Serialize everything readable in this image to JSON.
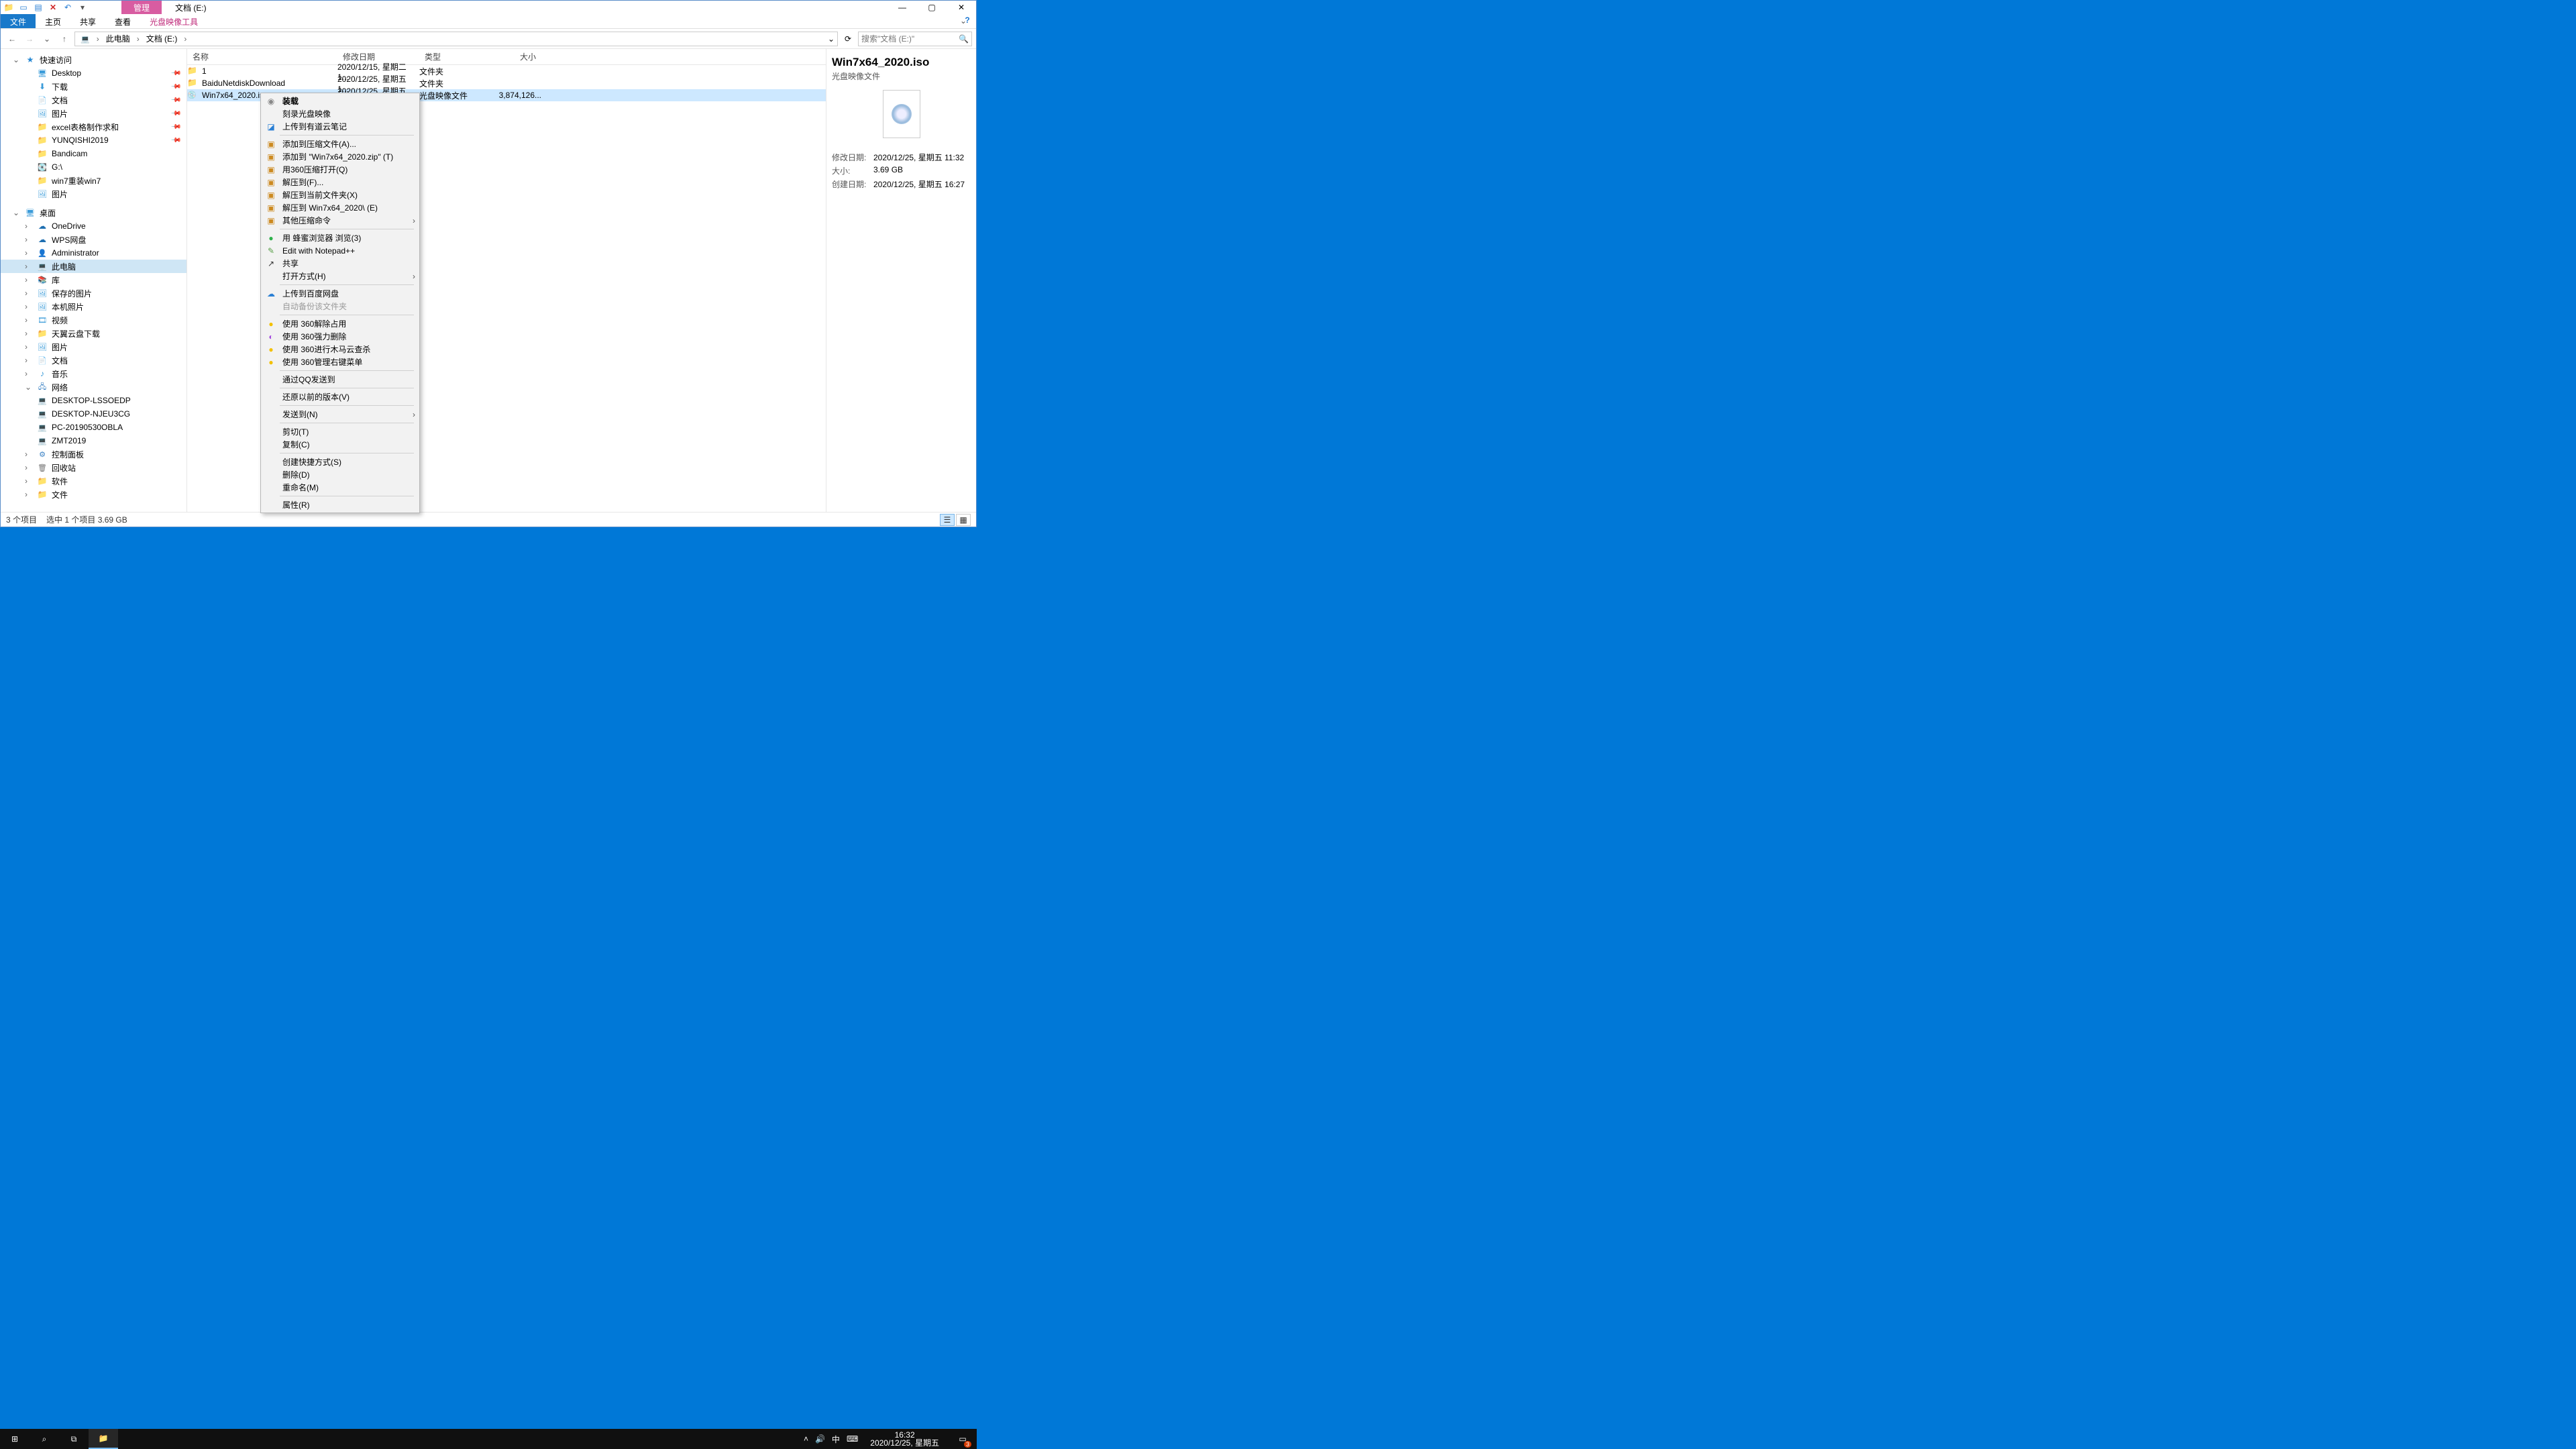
{
  "titlebar": {
    "context_tab": "管理",
    "caption": "文档 (E:)"
  },
  "ribbon": {
    "file": "文件",
    "home": "主页",
    "share": "共享",
    "view": "查看",
    "ctx": "光盘映像工具"
  },
  "nav": {
    "crumbs": [
      "此电脑",
      "文档 (E:)"
    ],
    "search_placeholder": "搜索\"文档 (E:)\""
  },
  "tree": {
    "quick": "快速访问",
    "quick_items": [
      {
        "label": "Desktop",
        "ico": "i-desk",
        "pin": true
      },
      {
        "label": "下载",
        "ico": "i-dl",
        "pin": true
      },
      {
        "label": "文档",
        "ico": "i-doc",
        "pin": true
      },
      {
        "label": "图片",
        "ico": "i-pic",
        "pin": true
      },
      {
        "label": "excel表格制作求和",
        "ico": "i-fold",
        "pin": true
      },
      {
        "label": "YUNQISHI2019",
        "ico": "i-fold",
        "pin": true
      },
      {
        "label": "Bandicam",
        "ico": "i-fold"
      },
      {
        "label": "G:\\",
        "ico": "i-disk"
      },
      {
        "label": "win7重装win7",
        "ico": "i-fold"
      },
      {
        "label": "图片",
        "ico": "i-pic"
      }
    ],
    "desktop": "桌面",
    "desktop_items": [
      {
        "label": "OneDrive",
        "ico": "i-one"
      },
      {
        "label": "WPS网盘",
        "ico": "i-one"
      },
      {
        "label": "Administrator",
        "ico": "i-user"
      },
      {
        "label": "此电脑",
        "ico": "i-pc",
        "sel": true
      },
      {
        "label": "库",
        "ico": "i-lib"
      }
    ],
    "lib_items": [
      {
        "label": "保存的图片",
        "ico": "i-pic"
      },
      {
        "label": "本机照片",
        "ico": "i-pic"
      },
      {
        "label": "视频",
        "ico": "i-vid"
      },
      {
        "label": "天翼云盘下载",
        "ico": "i-fold"
      },
      {
        "label": "图片",
        "ico": "i-pic"
      },
      {
        "label": "文档",
        "ico": "i-doc"
      },
      {
        "label": "音乐",
        "ico": "i-mus"
      }
    ],
    "network": "网络",
    "net_items": [
      {
        "label": "DESKTOP-LSSOEDP",
        "ico": "i-pc"
      },
      {
        "label": "DESKTOP-NJEU3CG",
        "ico": "i-pc"
      },
      {
        "label": "PC-20190530OBLA",
        "ico": "i-pc"
      },
      {
        "label": "ZMT2019",
        "ico": "i-pc"
      }
    ],
    "tail": [
      {
        "label": "控制面板",
        "ico": "i-cpl"
      },
      {
        "label": "回收站",
        "ico": "i-rec"
      },
      {
        "label": "软件",
        "ico": "i-fold"
      },
      {
        "label": "文件",
        "ico": "i-fold"
      }
    ]
  },
  "columns": {
    "name": "名称",
    "date": "修改日期",
    "type": "类型",
    "size": "大小"
  },
  "rows": [
    {
      "name": "1",
      "date": "2020/12/15, 星期二 1...",
      "type": "文件夹",
      "size": "",
      "ico": "i-fold"
    },
    {
      "name": "BaiduNetdiskDownload",
      "date": "2020/12/25, 星期五 1...",
      "type": "文件夹",
      "size": "",
      "ico": "i-fold"
    },
    {
      "name": "Win7x64_2020.iso",
      "date": "2020/12/25, 星期五 1...",
      "type": "光盘映像文件",
      "size": "3,874,126...",
      "ico": "i-iso",
      "sel": true
    }
  ],
  "preview": {
    "title": "Win7x64_2020.iso",
    "type": "光盘映像文件",
    "meta": [
      {
        "k": "修改日期:",
        "v": "2020/12/25, 星期五 11:32"
      },
      {
        "k": "大小:",
        "v": "3.69 GB"
      },
      {
        "k": "创建日期:",
        "v": "2020/12/25, 星期五 16:27"
      }
    ]
  },
  "status": {
    "count": "3 个项目",
    "sel": "选中 1 个项目  3.69 GB"
  },
  "ctx": [
    {
      "t": "装载",
      "ico": "i-cd",
      "bold": true
    },
    {
      "t": "刻录光盘映像"
    },
    {
      "t": "上传到有道云笔记",
      "ico": "i-yd"
    },
    {
      "sep": true
    },
    {
      "t": "添加到压缩文件(A)...",
      "ico": "i-box"
    },
    {
      "t": "添加到 \"Win7x64_2020.zip\" (T)",
      "ico": "i-box"
    },
    {
      "t": "用360压缩打开(Q)",
      "ico": "i-box"
    },
    {
      "t": "解压到(F)...",
      "ico": "i-box"
    },
    {
      "t": "解压到当前文件夹(X)",
      "ico": "i-box"
    },
    {
      "t": "解压到 Win7x64_2020\\ (E)",
      "ico": "i-box"
    },
    {
      "t": "其他压缩命令",
      "ico": "i-box",
      "sub": true
    },
    {
      "sep": true
    },
    {
      "t": "用 蜂蜜浏览器 浏览(3)",
      "ico": "i-ball"
    },
    {
      "t": "Edit with Notepad++",
      "ico": "i-np"
    },
    {
      "t": "共享",
      "ico": "i-shr"
    },
    {
      "t": "打开方式(H)",
      "sub": true
    },
    {
      "sep": true
    },
    {
      "t": "上传到百度网盘",
      "ico": "i-bd"
    },
    {
      "t": "自动备份该文件夹",
      "dim": true
    },
    {
      "sep": true
    },
    {
      "t": "使用 360解除占用",
      "ico": "i-360"
    },
    {
      "t": "使用 360强力删除",
      "ico": "i-warn"
    },
    {
      "t": "使用 360进行木马云查杀",
      "ico": "i-360"
    },
    {
      "t": "使用 360管理右键菜单",
      "ico": "i-360"
    },
    {
      "sep": true
    },
    {
      "t": "通过QQ发送到"
    },
    {
      "sep": true
    },
    {
      "t": "还原以前的版本(V)"
    },
    {
      "sep": true
    },
    {
      "t": "发送到(N)",
      "sub": true
    },
    {
      "sep": true
    },
    {
      "t": "剪切(T)"
    },
    {
      "t": "复制(C)"
    },
    {
      "sep": true
    },
    {
      "t": "创建快捷方式(S)"
    },
    {
      "t": "删除(D)"
    },
    {
      "t": "重命名(M)"
    },
    {
      "sep": true
    },
    {
      "t": "属性(R)"
    }
  ],
  "taskbar": {
    "time": "16:32",
    "date": "2020/12/25, 星期五",
    "ime": "中",
    "badge": "3"
  }
}
